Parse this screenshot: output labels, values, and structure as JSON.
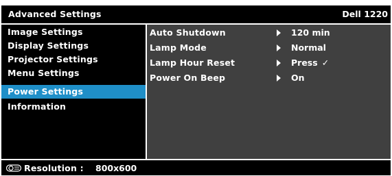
{
  "header": {
    "title": "Advanced Settings",
    "model": "Dell 1220"
  },
  "menu": {
    "items": [
      {
        "label": "Image Settings",
        "selected": false
      },
      {
        "label": "Display Settings",
        "selected": false
      },
      {
        "label": "Projector Settings",
        "selected": false
      },
      {
        "label": "Menu Settings",
        "selected": false
      },
      {
        "label": "Power Settings",
        "selected": true
      },
      {
        "label": "Information",
        "selected": false
      }
    ]
  },
  "options": [
    {
      "label": "Auto Shutdown",
      "value": "120 min",
      "check": ""
    },
    {
      "label": "Lamp Mode",
      "value": "Normal",
      "check": ""
    },
    {
      "label": "Lamp Hour Reset",
      "value": "Press",
      "check": "✓"
    },
    {
      "label": "Power On Beep",
      "value": "On",
      "check": ""
    }
  ],
  "status": {
    "icon": "projector-icon",
    "resolution_label": "Resolution :",
    "resolution_value": "800x600"
  },
  "colors": {
    "selected": "#1f8fc8",
    "panel": "#404040",
    "background": "#000000"
  }
}
